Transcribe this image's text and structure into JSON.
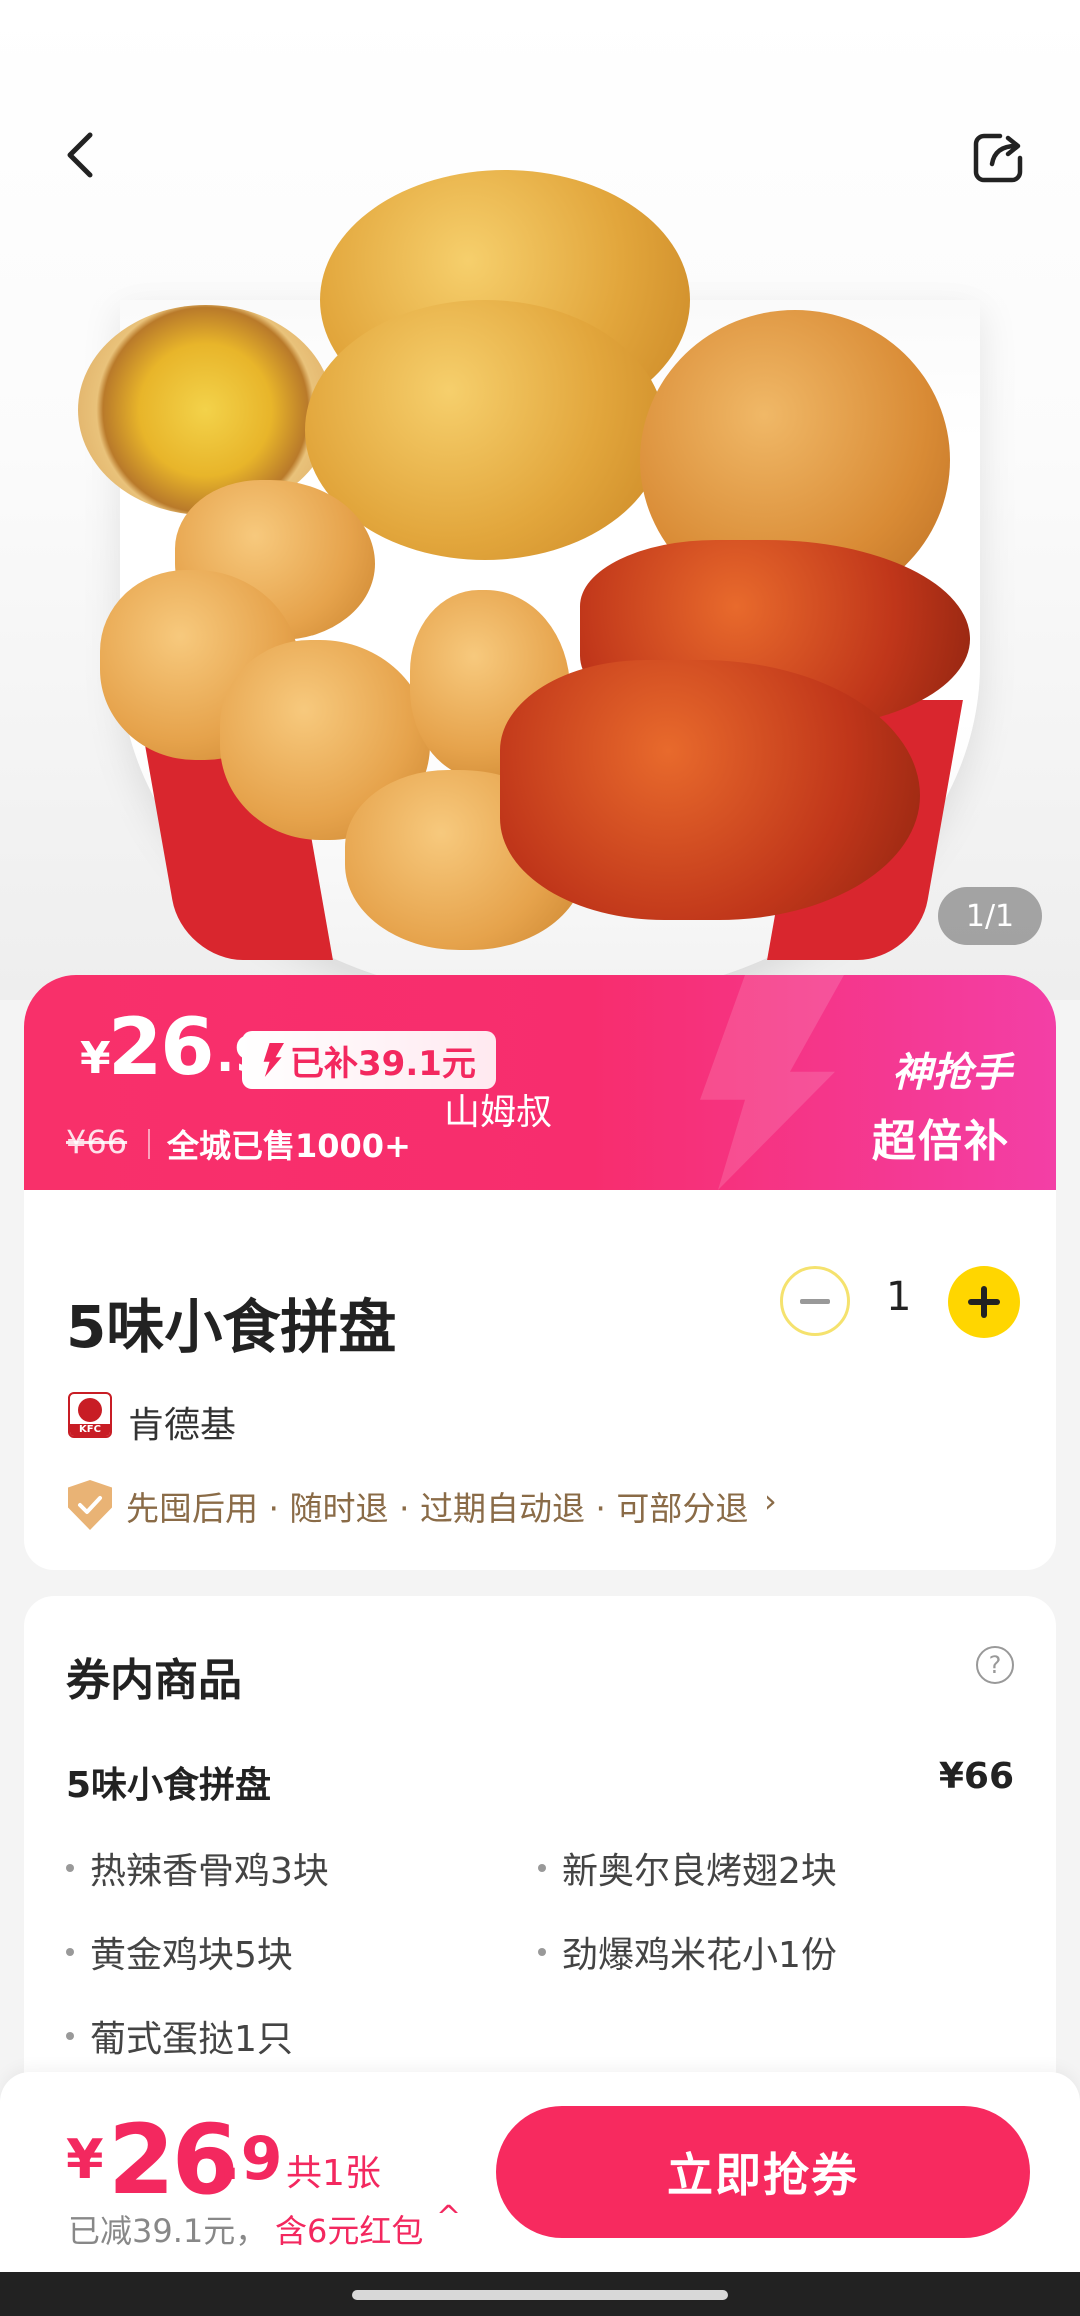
{
  "hero": {
    "image_counter": "1/1"
  },
  "promo": {
    "currency": "¥",
    "price_int": "26",
    "price_dec": ".9",
    "subsidy": "已补39.1元",
    "original_price": "¥66",
    "sold": "全城已售1000+",
    "watermark": "山姆叔",
    "tag_line1": "神抢手",
    "tag_line2": "超倍补"
  },
  "product": {
    "title": "5味小食拼盘",
    "quantity": "1",
    "brand": "肯德基",
    "brand_logo_text": "KFC",
    "guarantee": "先囤后用 · 随时退 · 过期自动退 · 可部分退",
    "guarantee_chevron": "›"
  },
  "voucher": {
    "section_title": "券内商品",
    "help": "?",
    "pack_name": "5味小食拼盘",
    "pack_price": "¥66",
    "items": [
      "热辣香骨鸡3块",
      "新奥尔良烤翅2块",
      "黄金鸡块5块",
      "劲爆鸡米花小1份",
      "葡式蛋挞1只"
    ]
  },
  "bottom": {
    "currency": "¥",
    "price_int": "26",
    "price_dec": ".9",
    "count": "共1张",
    "reduced": "已减39.1元，",
    "red_packet": "含6元红包",
    "up_arrow": "^",
    "buy_label": "立即抢券"
  },
  "colors": {
    "accent": "#f72a5f",
    "promo_end": "#f33fa6",
    "plus_yellow": "#ffd600",
    "guarantee_text": "#8a6b47"
  }
}
